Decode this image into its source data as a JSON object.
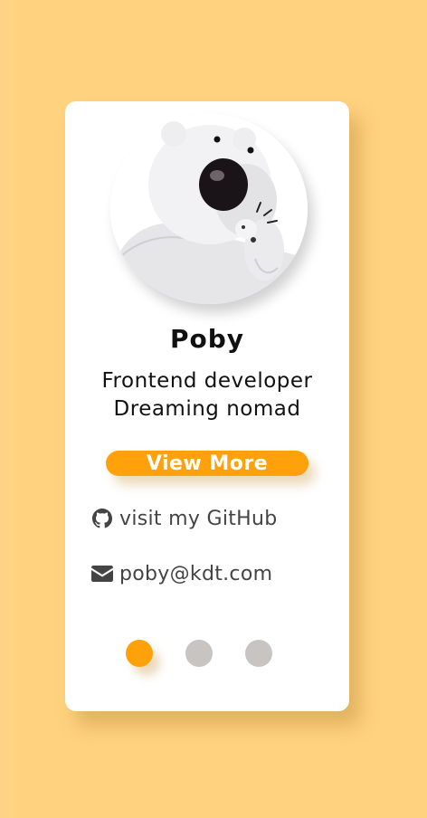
{
  "profile": {
    "name": "Poby",
    "role_line_1": "Frontend developer",
    "role_line_2": "Dreaming nomad",
    "avatar_icon": "polar-bear-avatar"
  },
  "actions": {
    "view_more_label": "View More"
  },
  "links": {
    "github_label": "visit my GitHub",
    "github_icon": "github-icon",
    "email_label": "poby@kdt.com",
    "email_icon": "envelope-icon"
  },
  "pagination": {
    "count": 3,
    "active_index": 0
  },
  "colors": {
    "background": "#ffd27f",
    "accent": "#ffa10a",
    "inactive_dot": "#c7c4c2",
    "card": "#ffffff"
  }
}
